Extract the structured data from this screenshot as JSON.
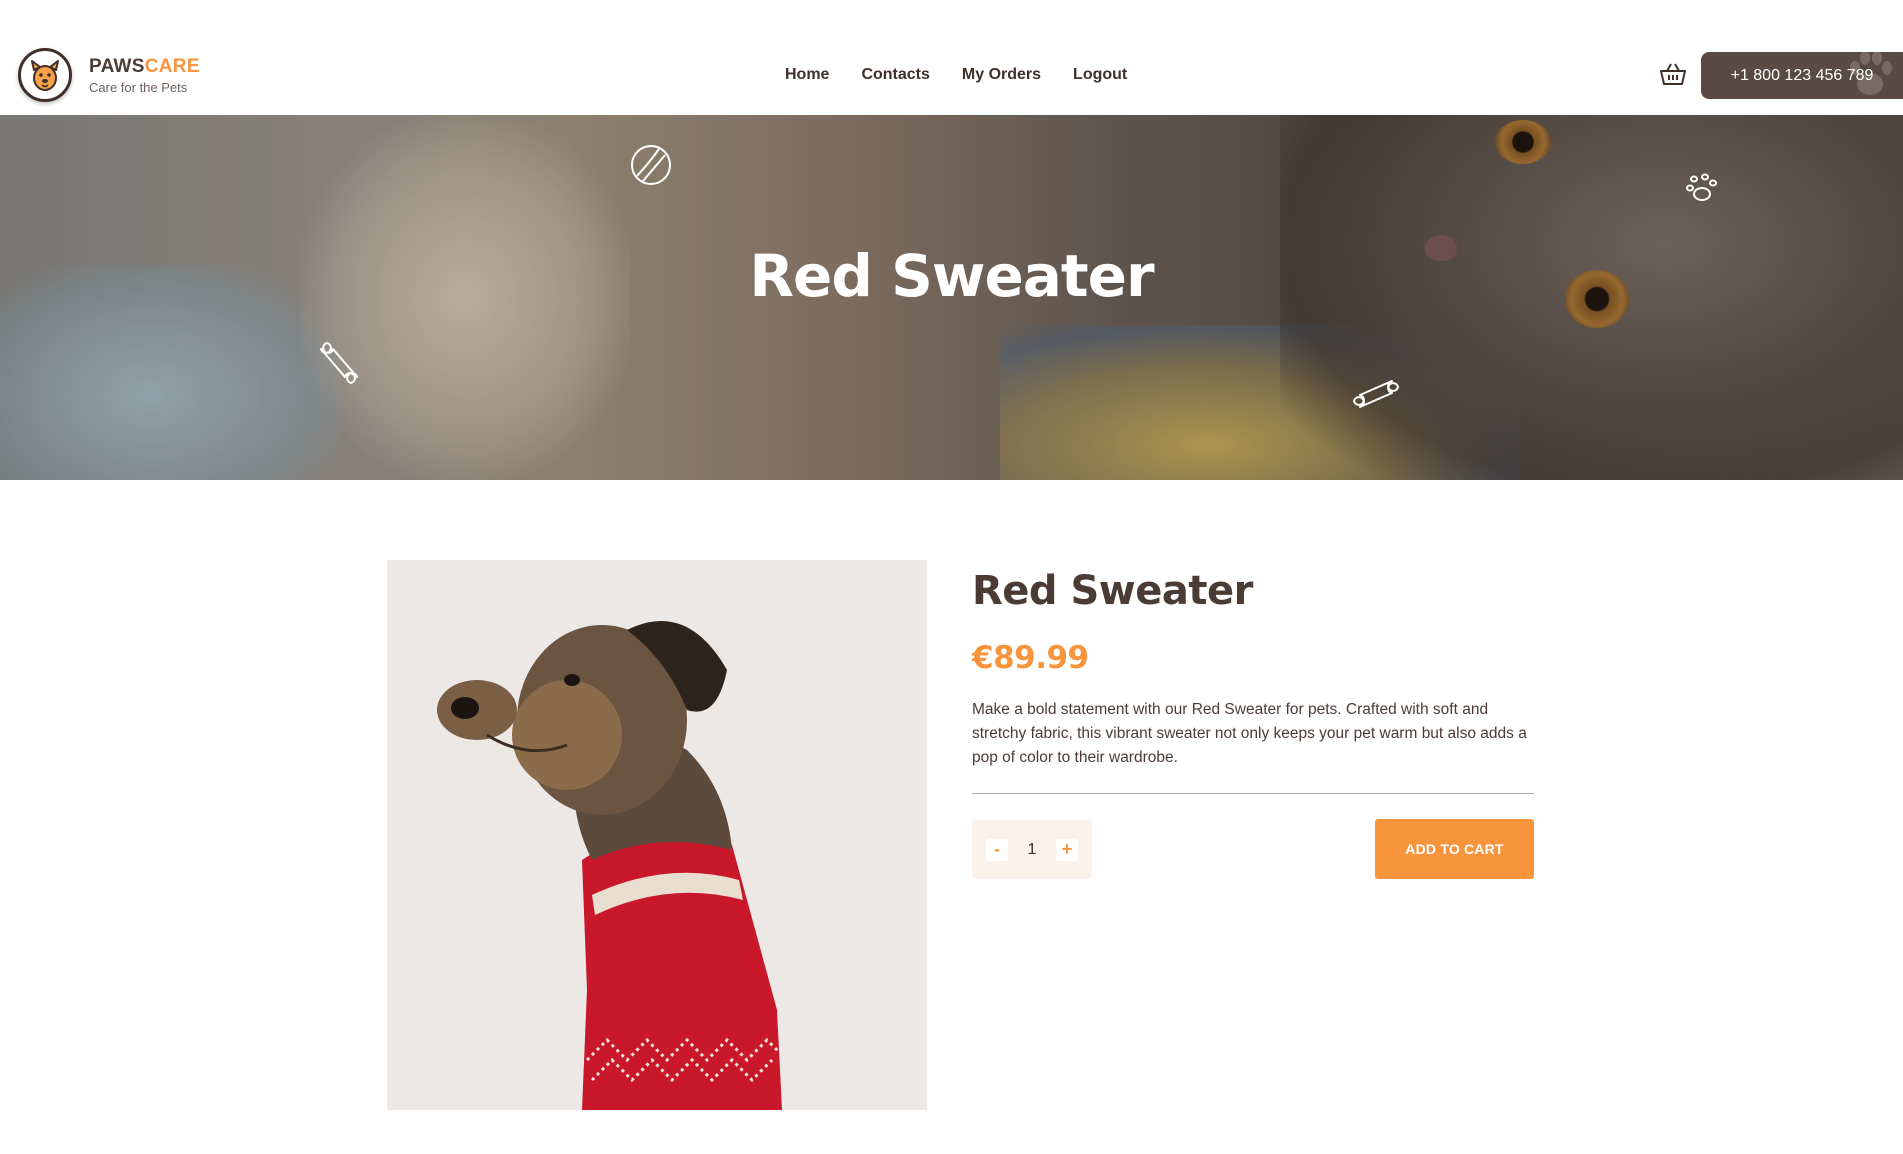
{
  "header": {
    "brand_part1": "PAWS",
    "brand_part2": "CARE",
    "tagline": "Care for the Pets",
    "nav": [
      "Home",
      "Contacts",
      "My Orders",
      "Logout"
    ],
    "phone": "+1 800 123 456 789",
    "icons": [
      "logo-dog-icon",
      "basket-icon",
      "paw-icon"
    ]
  },
  "hero": {
    "title": "Red Sweater",
    "decor_icons": [
      "ball-icon",
      "paw-icon",
      "bone-icon",
      "bone-icon"
    ]
  },
  "product": {
    "title": "Red Sweater",
    "price": "€89.99",
    "description": "Make a bold statement with our Red Sweater for pets. Crafted with soft and stretchy fabric, this vibrant sweater not only keeps your pet warm but also adds a pop of color to their wardrobe.",
    "quantity": "1",
    "minus_label": "-",
    "plus_label": "+",
    "add_to_cart_label": "ADD TO CART"
  },
  "colors": {
    "accent": "#f7943c",
    "dark": "#4a3b35",
    "phone_bg": "#5a4a44"
  }
}
